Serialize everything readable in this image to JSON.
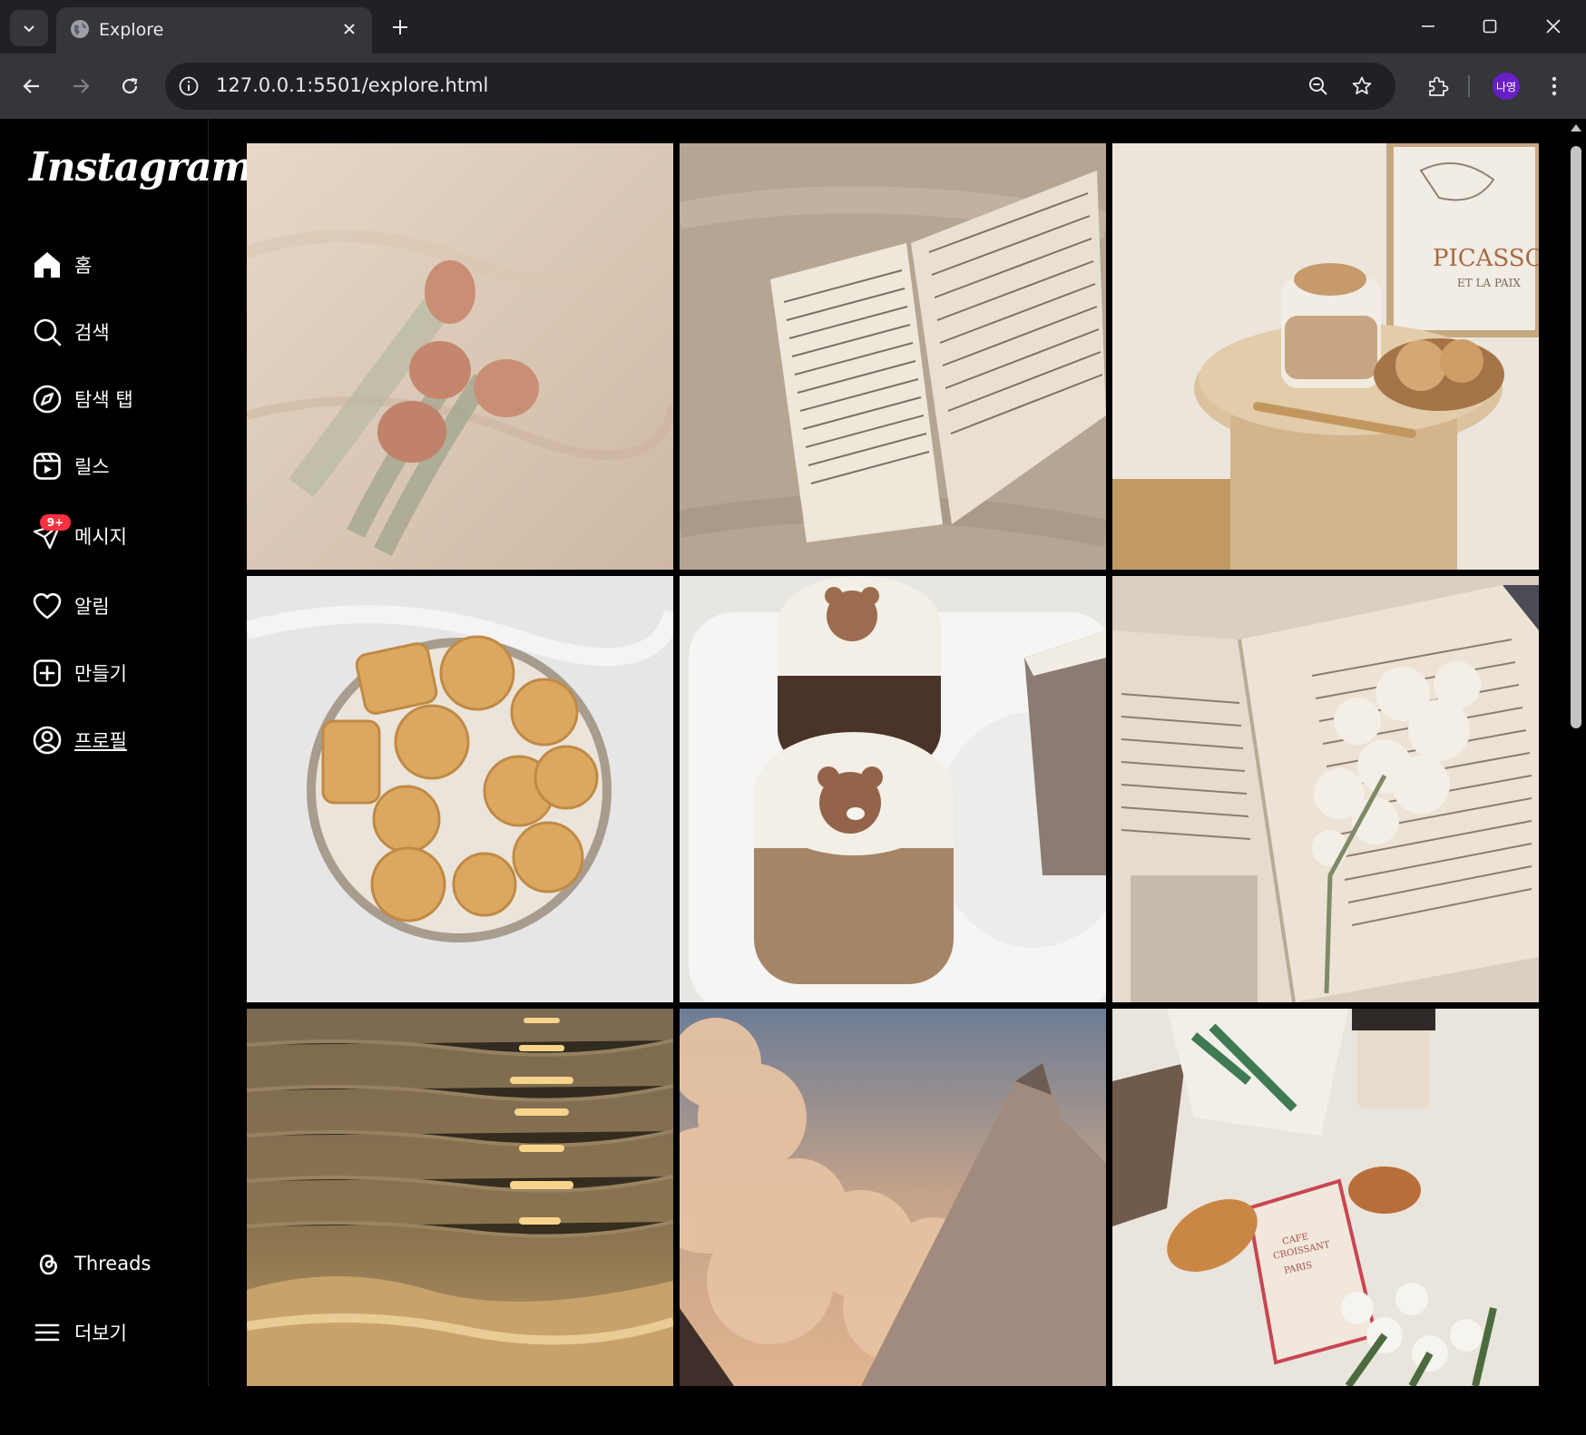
{
  "browser": {
    "tab_title": "Explore",
    "url": "127.0.0.1:5501/explore.html",
    "profile_initials": "나영"
  },
  "sidebar": {
    "logo": "Instagram",
    "items": [
      {
        "label": "홈",
        "icon": "home-icon"
      },
      {
        "label": "검색",
        "icon": "search-icon"
      },
      {
        "label": "탐색 탭",
        "icon": "compass-icon"
      },
      {
        "label": "릴스",
        "icon": "reels-icon"
      },
      {
        "label": "메시지",
        "icon": "paper-plane-icon",
        "badge": "9+"
      },
      {
        "label": "알림",
        "icon": "heart-icon"
      },
      {
        "label": "만들기",
        "icon": "plus-square-icon"
      },
      {
        "label": "프로필",
        "icon": "user-circle-icon"
      }
    ],
    "bottom": [
      {
        "label": "Threads",
        "icon": "threads-icon"
      },
      {
        "label": "더보기",
        "icon": "menu-icon"
      }
    ]
  },
  "grid": {
    "tiles": [
      {
        "name": "tulips-on-linen"
      },
      {
        "name": "open-book-on-bed"
      },
      {
        "name": "latte-and-cookies-table",
        "text_line1": "PICASSO",
        "text_line2": "ET LA PAIX"
      },
      {
        "name": "butter-cookie-tin"
      },
      {
        "name": "bear-latte-cups"
      },
      {
        "name": "book-with-lilac"
      },
      {
        "name": "sunset-sea-waves"
      },
      {
        "name": "airplane-wing-clouds"
      },
      {
        "name": "picnic-croissant-book",
        "text_line1": "CAFE",
        "text_line2": "CROISSANT",
        "text_line3": "PARIS"
      }
    ]
  },
  "colors": {
    "accent_badge": "#ff3040",
    "chrome_dark": "#202124",
    "chrome_mid": "#35363a"
  }
}
